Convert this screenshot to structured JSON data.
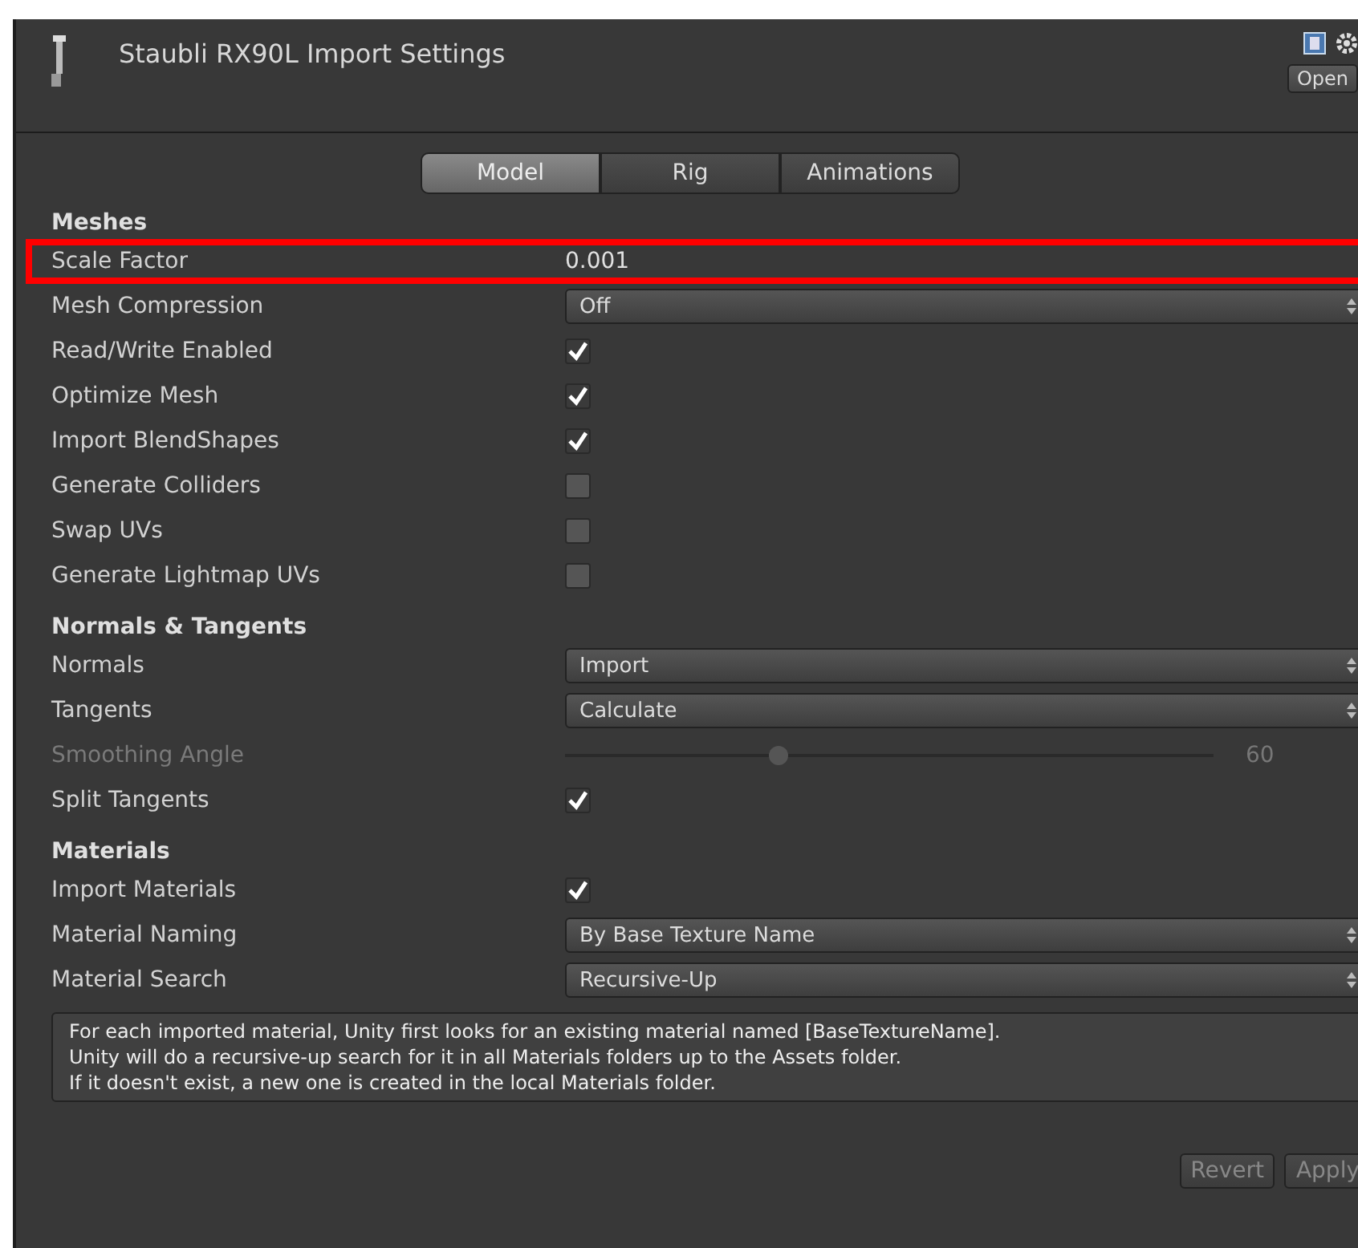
{
  "header": {
    "title": "Staubli RX90L Import Settings",
    "open_button": "Open"
  },
  "tabs": [
    {
      "label": "Model",
      "selected": true
    },
    {
      "label": "Rig",
      "selected": false
    },
    {
      "label": "Animations",
      "selected": false
    }
  ],
  "sections": [
    {
      "title": "Meshes",
      "rows": [
        {
          "kind": "field",
          "label": "Scale Factor",
          "value": "0.001",
          "highlighted": true
        },
        {
          "kind": "dropdown",
          "label": "Mesh Compression",
          "value": "Off"
        },
        {
          "kind": "checkbox",
          "label": "Read/Write Enabled",
          "checked": true
        },
        {
          "kind": "checkbox",
          "label": "Optimize Mesh",
          "checked": true
        },
        {
          "kind": "checkbox",
          "label": "Import BlendShapes",
          "checked": true
        },
        {
          "kind": "checkbox",
          "label": "Generate Colliders",
          "checked": false
        },
        {
          "kind": "checkbox",
          "label": "Swap UVs",
          "checked": false
        },
        {
          "kind": "checkbox",
          "label": "Generate Lightmap UVs",
          "checked": false
        }
      ]
    },
    {
      "title": "Normals & Tangents",
      "rows": [
        {
          "kind": "dropdown",
          "label": "Normals",
          "value": "Import"
        },
        {
          "kind": "dropdown",
          "label": "Tangents",
          "value": "Calculate"
        },
        {
          "kind": "slider",
          "label": "Smoothing Angle",
          "level": 0.33,
          "reading": "60",
          "disabled": true
        },
        {
          "kind": "checkbox",
          "label": "Split Tangents",
          "checked": true
        }
      ]
    },
    {
      "title": "Materials",
      "rows": [
        {
          "kind": "checkbox",
          "label": "Import Materials",
          "checked": true
        },
        {
          "kind": "dropdown",
          "label": "Material Naming",
          "value": "By Base Texture Name"
        },
        {
          "kind": "dropdown",
          "label": "Material Search",
          "value": "Recursive-Up"
        }
      ]
    }
  ],
  "help_text": [
    "For each imported material, Unity first looks for an existing material named [BaseTextureName].",
    "Unity will do a recursive-up search for it in all Materials folders up to the Assets folder.",
    "If it doesn't exist, a new one is created in the local Materials folder."
  ],
  "buttons": [
    "Revert",
    "Apply"
  ]
}
